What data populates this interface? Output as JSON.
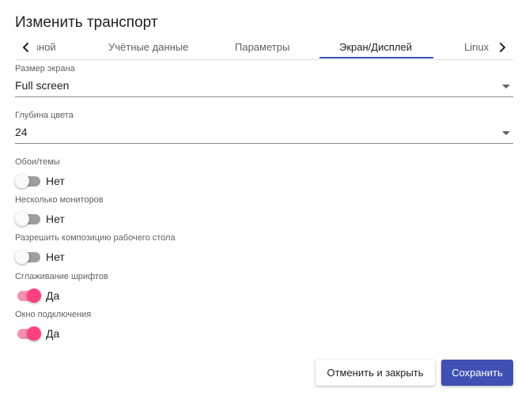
{
  "dialog": {
    "title": "Изменить транспорт"
  },
  "tabs": [
    {
      "label": "вной"
    },
    {
      "label": "Учётные данные"
    },
    {
      "label": "Параметры"
    },
    {
      "label": "Экран/Дисплей",
      "active": true
    },
    {
      "label": "Linux"
    }
  ],
  "fields": {
    "screen_size": {
      "label": "Размер экрана",
      "value": "Full screen"
    },
    "color_depth": {
      "label": "Глубина цвета",
      "value": "24"
    }
  },
  "toggles": [
    {
      "label": "Обои/темы",
      "state_text": "Нет",
      "on": false
    },
    {
      "label": "Несколько мониторов",
      "state_text": "Нет",
      "on": false
    },
    {
      "label": "Разрешить композицию рабочего стола",
      "state_text": "Нет",
      "on": false
    },
    {
      "label": "Сглаживание шрифтов",
      "state_text": "Да",
      "on": true
    },
    {
      "label": "Окно подключения",
      "state_text": "Да",
      "on": true
    }
  ],
  "actions": {
    "cancel_label": "Отменить и закрыть",
    "save_label": "Сохранить"
  },
  "colors": {
    "primary": "#3f51b5",
    "accent": "#ff4081",
    "accent_track": "#f48fb1"
  },
  "icons": {
    "tab_prev": "chevron-left-icon",
    "tab_next": "chevron-right-icon",
    "dropdown": "caret-down-icon"
  }
}
